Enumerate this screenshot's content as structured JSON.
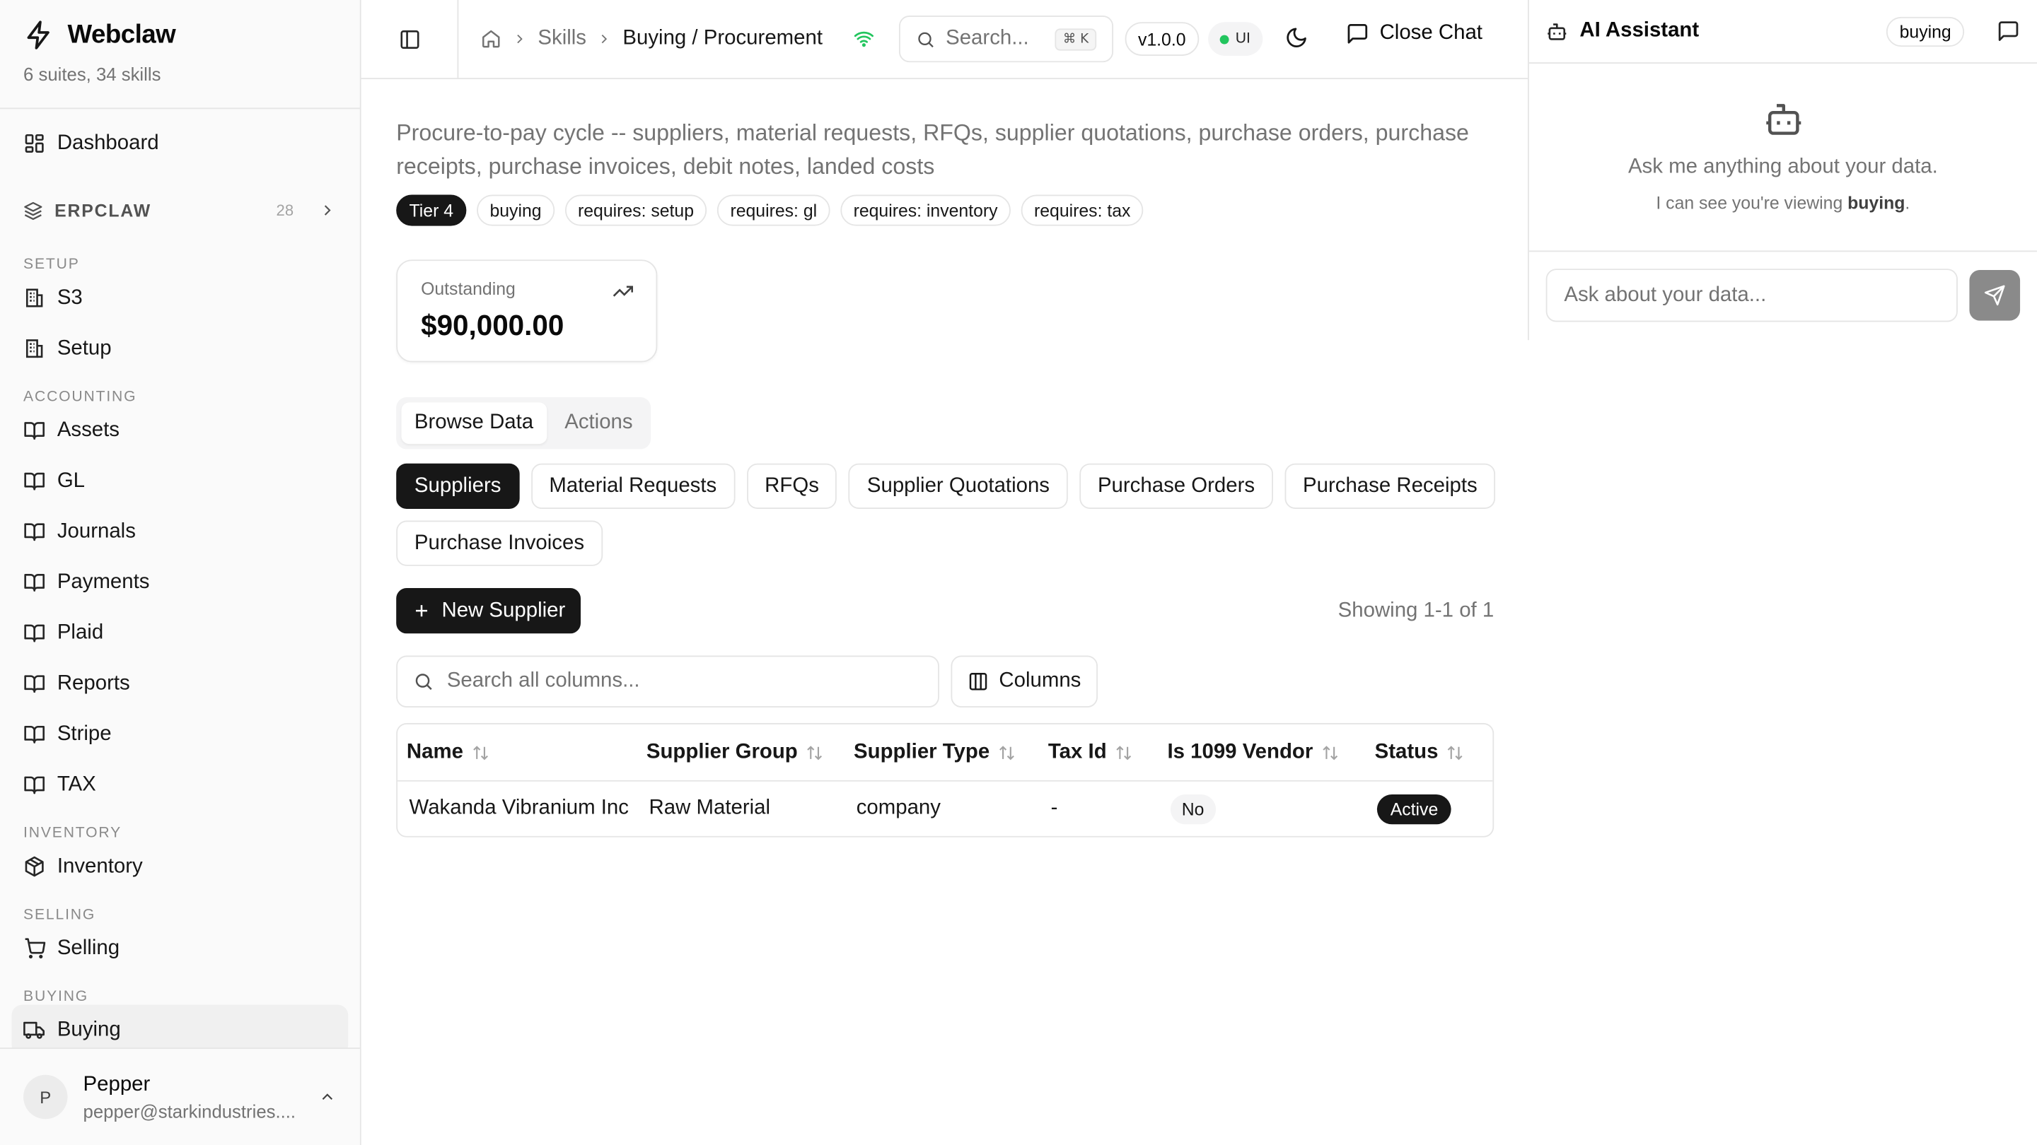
{
  "app": {
    "name": "Webclaw",
    "subtitle": "6 suites, 34 skills"
  },
  "sidebar": {
    "dashboard_label": "Dashboard",
    "section": {
      "title": "ERPCLAW",
      "count": "28"
    },
    "groups": [
      {
        "label": "SETUP",
        "items": [
          "S3",
          "Setup"
        ]
      },
      {
        "label": "ACCOUNTING",
        "items": [
          "Assets",
          "GL",
          "Journals",
          "Payments",
          "Plaid",
          "Reports",
          "Stripe",
          "TAX"
        ]
      },
      {
        "label": "INVENTORY",
        "items": [
          "Inventory"
        ]
      },
      {
        "label": "SELLING",
        "items": [
          "Selling"
        ]
      },
      {
        "label": "BUYING",
        "items": [
          "Buying"
        ]
      }
    ],
    "user": {
      "initial": "P",
      "name": "Pepper",
      "email": "pepper@starkindustries...."
    }
  },
  "topbar": {
    "breadcrumb": [
      "Skills",
      "Buying / Procurement"
    ],
    "search_placeholder": "Search...",
    "search_shortcut": "⌘ K",
    "version": "v1.0.0",
    "ui_badge": "UI",
    "close_chat_label": "Close Chat",
    "status_color": "#22c55e"
  },
  "page": {
    "description": "Procure-to-pay cycle -- suppliers, material requests, RFQs, supplier quotations, purchase orders, purchase receipts, purchase invoices, debit notes, landed costs",
    "tags": [
      "Tier 4",
      "buying",
      "requires: setup",
      "requires: gl",
      "requires: inventory",
      "requires: tax"
    ],
    "stat": {
      "label": "Outstanding",
      "value": "$90,000.00"
    },
    "view_tabs": [
      "Browse Data",
      "Actions"
    ],
    "entity_tabs": [
      "Suppliers",
      "Material Requests",
      "RFQs",
      "Supplier Quotations",
      "Purchase Orders",
      "Purchase Receipts",
      "Purchase Invoices"
    ],
    "new_button_label": "New Supplier",
    "showing_text": "Showing 1-1 of 1",
    "column_search_placeholder": "Search all columns...",
    "columns_button_label": "Columns"
  },
  "table": {
    "columns": [
      "Name",
      "Supplier Group",
      "Supplier Type",
      "Tax Id",
      "Is 1099 Vendor",
      "Status"
    ],
    "rows": [
      [
        "Wakanda Vibranium Inc",
        "Raw Material",
        "company",
        "-",
        "No",
        "Active"
      ]
    ]
  },
  "chat": {
    "title": "AI Assistant",
    "context_badge": "buying",
    "empty_message": "Ask me anything about your data.",
    "hint_prefix": "I can see you're viewing ",
    "hint_context": "buying",
    "hint_suffix": ".",
    "input_placeholder": "Ask about your data..."
  }
}
